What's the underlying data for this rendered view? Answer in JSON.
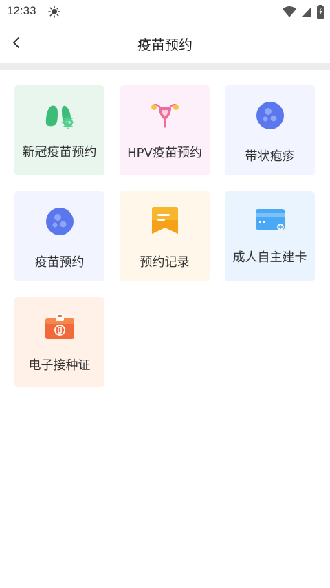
{
  "status_bar": {
    "time": "12:33"
  },
  "nav": {
    "title": "疫苗预约"
  },
  "tiles": [
    {
      "label": "新冠疫苗预约",
      "icon": "lungs-virus-icon",
      "badge": "19"
    },
    {
      "label": "HPV疫苗预约",
      "icon": "uterus-icon"
    },
    {
      "label": "带状疱疹",
      "icon": "cells-icon"
    },
    {
      "label": "疫苗预约",
      "icon": "cells-icon"
    },
    {
      "label": "预约记录",
      "icon": "note-icon"
    },
    {
      "label": "成人自主建卡",
      "icon": "card-icon"
    },
    {
      "label": "电子接种证",
      "icon": "certificate-icon"
    }
  ]
}
